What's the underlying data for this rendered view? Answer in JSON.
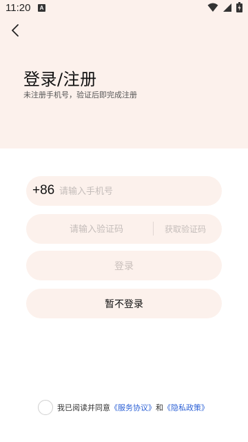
{
  "status_bar": {
    "time": "11:20",
    "notif_icon": "A"
  },
  "header": {
    "title": "登录/注册",
    "subtitle": "未注册手机号，验证后即完成注册"
  },
  "form": {
    "country_code": "+86",
    "phone_placeholder": "请输入手机号",
    "phone_value": "",
    "code_placeholder": "请输入验证码",
    "code_value": "",
    "get_code_label": "获取验证码",
    "login_label": "登录",
    "skip_label": "暂不登录"
  },
  "agreement": {
    "prefix": "我已阅读并同意",
    "service_link": "《服务协议》",
    "conjunction": "和",
    "privacy_link": "《隐私政策》",
    "checked": false
  },
  "colors": {
    "accent_bg": "#fcf1ec",
    "link": "#2e62d6"
  }
}
